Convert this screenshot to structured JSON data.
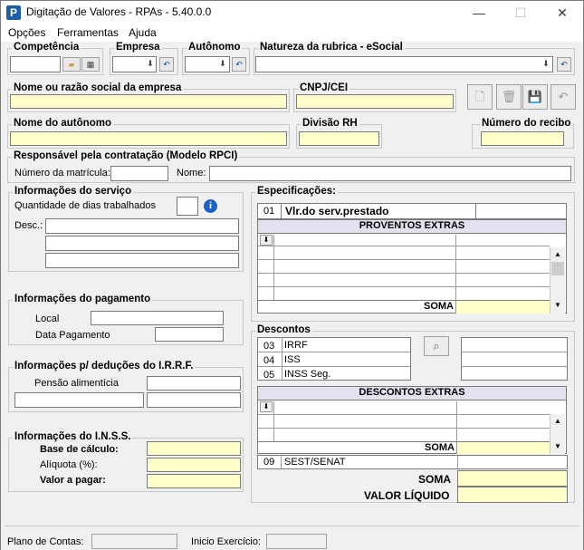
{
  "window": {
    "title": "Digitação de Valores - RPAs - 5.40.0.0",
    "minimize": "—",
    "maximize": "☐",
    "close": "✕",
    "app_icon": "P"
  },
  "menu": [
    "Opções",
    "Ferramentas",
    "Ajuda"
  ],
  "top": {
    "competencia": "Competência",
    "empresa": "Empresa",
    "autonomo": "Autônomo",
    "natureza": "Natureza da rubrica - eSocial"
  },
  "empresa_box": {
    "nome": "Nome ou razão social da empresa",
    "cnpj": "CNPJ/CEI"
  },
  "autonomo_box": {
    "nome": "Nome do autônomo",
    "divisao": "Divisão RH",
    "recibo": "Número do recibo"
  },
  "responsavel": {
    "title": "Responsável pela contratação (Modelo RPCI)",
    "matricula": "Número da matrícula:",
    "nome": "Nome:"
  },
  "servico": {
    "title": "Informações do serviço",
    "dias": "Quantidade de dias trabalhados",
    "desc": "Desc.:"
  },
  "pagamento": {
    "title": "Informações do pagamento",
    "local": "Local",
    "data": "Data Pagamento"
  },
  "irrf": {
    "title": "Informações p/ deduções do I.R.R.F.",
    "pensao": "Pensão alimentícia"
  },
  "inss": {
    "title": "Informações do I.N.S.S.",
    "base": "Base de cálculo:",
    "aliquota": "Alíquota (%):",
    "valor": "Valor a pagar:"
  },
  "especificacoes": {
    "title": "Especificações:",
    "code": "01",
    "item": "Vlr.do serv.prestado",
    "extras": "PROVENTOS EXTRAS",
    "soma": "SOMA"
  },
  "descontos": {
    "title": "Descontos",
    "rows": [
      {
        "code": "03",
        "name": "IRRF"
      },
      {
        "code": "04",
        "name": "ISS"
      },
      {
        "code": "05",
        "name": "INSS Seg."
      }
    ],
    "extras": "DESCONTOS EXTRAS",
    "soma": "SOMA",
    "sest_code": "09",
    "sest": "SEST/SENAT",
    "soma_total": "SOMA",
    "liquido": "VALOR LÍQUIDO"
  },
  "status": {
    "plano": "Plano de Contas:",
    "inicio": "Inicio Exercício:"
  },
  "colors": {
    "yellow": "#ffffcc",
    "header": "#e2e2ef"
  }
}
